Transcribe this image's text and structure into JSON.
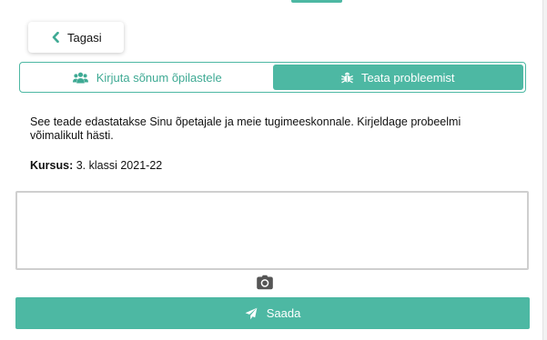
{
  "nav": {
    "back_label": "Tagasi"
  },
  "tabs": [
    {
      "label": "Kirjuta sõnum õpilastele",
      "icon": "users-icon",
      "active": false
    },
    {
      "label": "Teata probleemist",
      "icon": "bug-icon",
      "active": true
    }
  ],
  "description": "See teade edastatakse Sinu õpetajale ja meie tugimeeskonnale. Kirjeldage probeelmi võimalikult hästi.",
  "course": {
    "label": "Kursus:",
    "value": "3. klassi 2021-22"
  },
  "message": {
    "value": "",
    "placeholder": ""
  },
  "attach_icon": "camera-icon",
  "send": {
    "label": "Saada",
    "icon": "paper-plane-icon"
  },
  "colors": {
    "accent": "#4db8a3",
    "text": "#111111",
    "input_border": "#cfcfcf"
  }
}
